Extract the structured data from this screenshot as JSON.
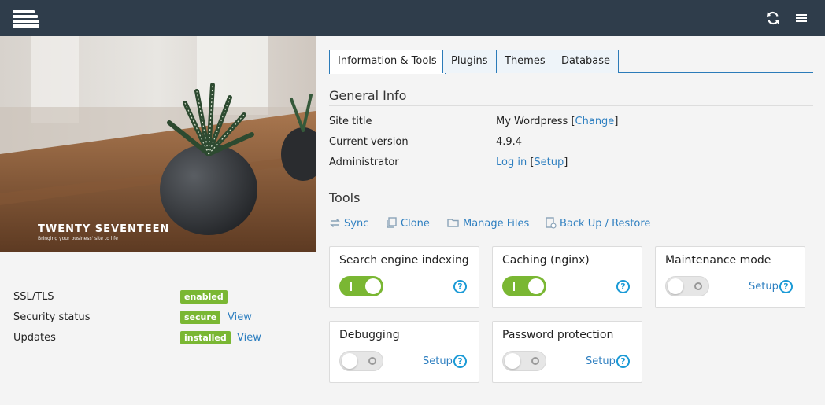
{
  "header": {
    "logo_icon": "stacked-layers-logo",
    "refresh_icon": "refresh-icon",
    "menu_icon": "hamburger-menu-icon",
    "bg_color": "#2f3d4b"
  },
  "preview": {
    "theme_title": "TWENTY SEVENTEEN",
    "theme_tagline": "Bringing your business' site to life"
  },
  "status": [
    {
      "label": "SSL/TLS",
      "badge": "enabled"
    },
    {
      "label": "Security status",
      "badge": "secure",
      "link": "View"
    },
    {
      "label": "Updates",
      "badge": "installed",
      "link": "View"
    }
  ],
  "tabs": [
    {
      "label": "Information & Tools",
      "active": true
    },
    {
      "label": "Plugins"
    },
    {
      "label": "Themes"
    },
    {
      "label": "Database"
    }
  ],
  "general_info": {
    "title": "General Info",
    "rows": {
      "site_title": {
        "label": "Site title",
        "value": "My Wordpress",
        "lbracket": " [",
        "link": "Change",
        "rbracket": "]"
      },
      "version": {
        "label": "Current version",
        "value": "4.9.4"
      },
      "admin": {
        "label": "Administrator",
        "link": "Log in",
        "lbracket": " [",
        "link2": "Setup",
        "rbracket": "]"
      }
    }
  },
  "tools": {
    "title": "Tools",
    "actions": [
      {
        "label": "Sync",
        "icon": "sync-icon"
      },
      {
        "label": "Clone",
        "icon": "clone-icon"
      },
      {
        "label": "Manage Files",
        "icon": "folder-icon"
      },
      {
        "label": "Back Up / Restore",
        "icon": "backup-icon"
      }
    ],
    "cards": [
      {
        "title": "Search engine indexing",
        "state": "on",
        "help": "?"
      },
      {
        "title": "Caching (nginx)",
        "state": "on",
        "help": "?"
      },
      {
        "title": "Maintenance mode",
        "state": "off",
        "setup": "Setup",
        "help": "?"
      },
      {
        "title": "Debugging",
        "state": "off",
        "setup": "Setup",
        "help": "?"
      },
      {
        "title": "Password protection",
        "state": "off",
        "setup": "Setup",
        "help": "?"
      }
    ]
  },
  "colors": {
    "accent": "#2e7fc0",
    "success": "#7ab733",
    "help": "#1a9ad6"
  }
}
